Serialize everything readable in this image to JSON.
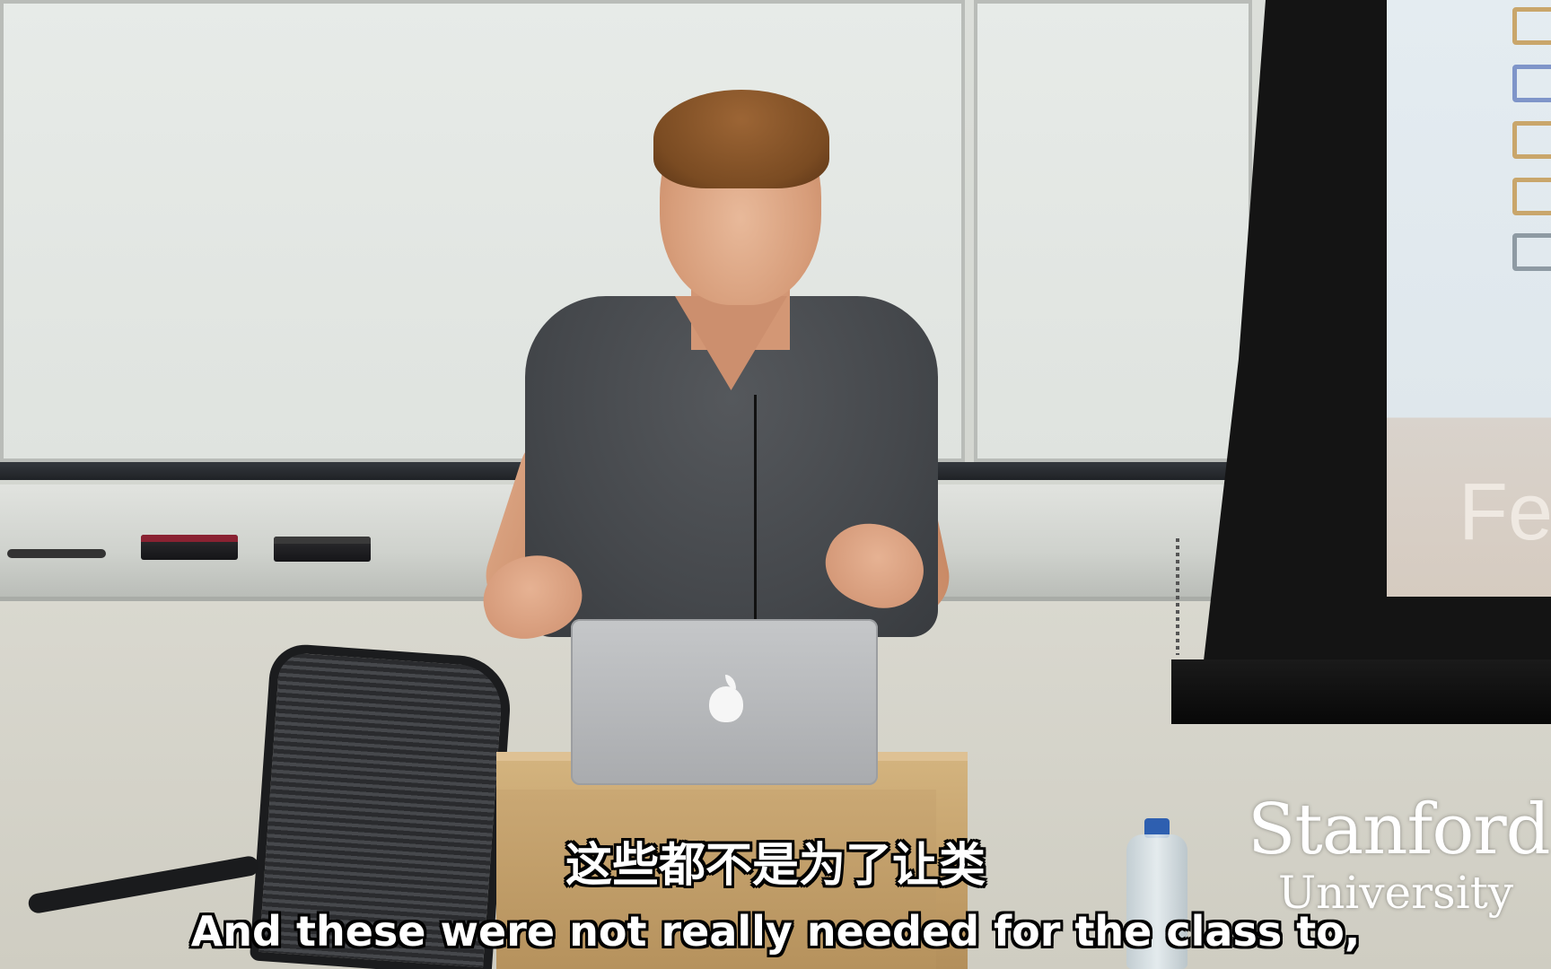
{
  "logo": {
    "line1": "Stanford",
    "line2": "University"
  },
  "subtitles": {
    "chinese": "这些都不是为了让类",
    "english": "And these were not really needed for the class to,"
  },
  "slide": {
    "visible_text_fragment": "Fe"
  },
  "colors": {
    "subtitle_text": "#ffffff",
    "subtitle_outline": "#000000",
    "logo_text": "#ffffff"
  }
}
